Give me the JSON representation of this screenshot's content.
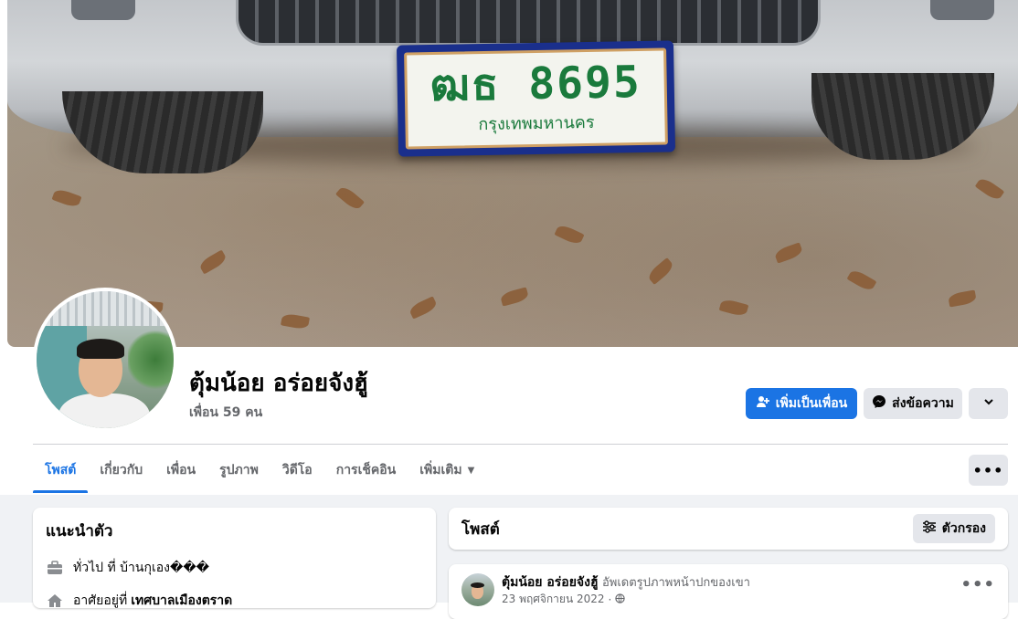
{
  "cover": {
    "plate_main": "ฒธ 8695",
    "plate_sub": "กรุงเทพมหานคร"
  },
  "profile": {
    "name": "ตุ้มน้อย อร่อยจังฮู้",
    "friends": "เพื่อน 59 คน"
  },
  "actions": {
    "add_friend": "เพิ่มเป็นเพื่อน",
    "message": "ส่งข้อความ"
  },
  "tabs": [
    {
      "label": "โพสต์",
      "active": true
    },
    {
      "label": "เกี่ยวกับ"
    },
    {
      "label": "เพื่อน"
    },
    {
      "label": "รูปภาพ"
    },
    {
      "label": "วิดีโอ"
    },
    {
      "label": "การเช็คอิน"
    },
    {
      "label": "เพิ่มเติม"
    }
  ],
  "intro": {
    "title": "แนะนำตัว",
    "work": "ทั่วไป ที่ บ้านกุเอง���",
    "lives_prefix": "อาศัยอยู่ที่",
    "lives_place": "เทศบาลเมืองตราด"
  },
  "posts": {
    "title": "โพสต์",
    "filter_label": "ตัวกรอง"
  },
  "post": {
    "author": "ตุ้มน้อย อร่อยจังฮู้",
    "action": "อัพเดตรูปภาพหน้าปกของเขา",
    "date": "23 พฤศจิกายน 2022",
    "privacy_icon": "globe-icon"
  },
  "colors": {
    "accent": "#1b74e4",
    "secondary_button": "#e4e6eb",
    "muted_text": "#65676b",
    "feed_bg": "#f0f2f5"
  }
}
